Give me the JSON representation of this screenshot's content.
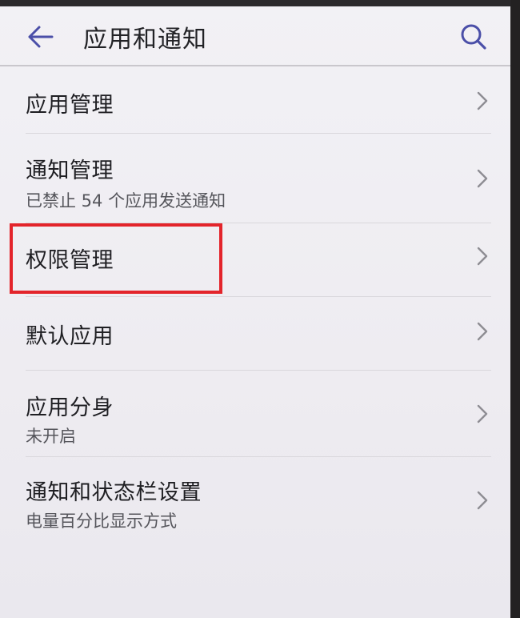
{
  "header": {
    "title": "应用和通知",
    "back_icon": "arrow-left-icon",
    "search_icon": "search-icon",
    "accent_color": "#4b4fa8"
  },
  "list": {
    "items": [
      {
        "label": "应用管理",
        "sub": ""
      },
      {
        "label": "通知管理",
        "sub": "已禁止 54 个应用发送通知"
      },
      {
        "label": "权限管理",
        "sub": ""
      },
      {
        "label": "默认应用",
        "sub": ""
      },
      {
        "label": "应用分身",
        "sub": "未开启"
      },
      {
        "label": "通知和状态栏设置",
        "sub": "电量百分比显示方式"
      }
    ]
  },
  "highlight": {
    "target_label": "权限管理",
    "color": "#e3242b"
  }
}
